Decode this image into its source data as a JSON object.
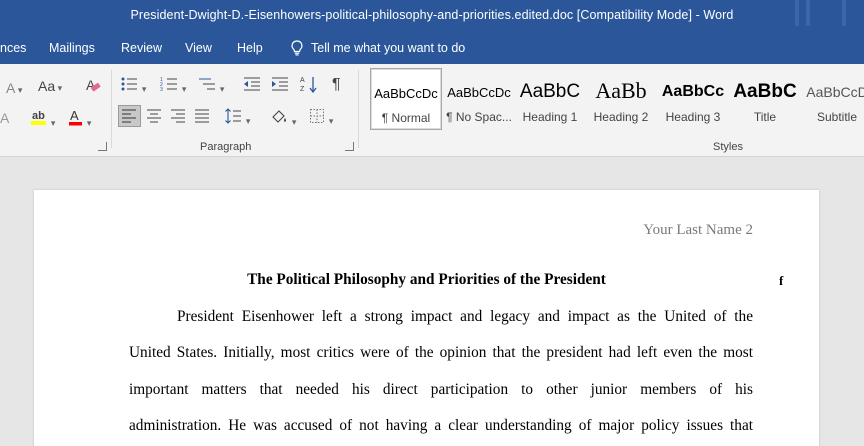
{
  "window": {
    "title": "President-Dwight-D.-Eisenhowers-political-philosophy-and-priorities.edited.doc [Compatibility Mode]  -  Word"
  },
  "menu": {
    "tabs": [
      "nces",
      "Mailings",
      "Review",
      "View",
      "Help"
    ],
    "tell_me": "Tell me what you want to do",
    "tell_me_icon": "lightbulb-icon"
  },
  "ribbon": {
    "font_group": {
      "change_case": "Aa",
      "clear_format_icon": "eraser-icon",
      "highlight_color": "#ffff00",
      "font_color": "#ff0000"
    },
    "paragraph_group": {
      "label": "Paragraph",
      "bullets_icon": "bullets-icon",
      "numbering_icon": "numbering-icon",
      "multilevel_icon": "multilevel-list-icon",
      "decrease_indent_icon": "decrease-indent-icon",
      "increase_indent_icon": "increase-indent-icon",
      "sort_icon": "sort-icon",
      "show_marks": "¶",
      "active_alignment": "align-left"
    },
    "styles_group": {
      "label": "Styles",
      "items": [
        {
          "sample": "AaBbCcDc",
          "name": "¶ Normal",
          "selected": true
        },
        {
          "sample": "AaBbCcDc",
          "name": "¶ No Spac..."
        },
        {
          "sample": "AaBbC",
          "name": "Heading 1"
        },
        {
          "sample": "AaBb",
          "name": "Heading 2"
        },
        {
          "sample": "AaBbCc",
          "name": "Heading 3"
        },
        {
          "sample": "AaBbC",
          "name": "Title"
        },
        {
          "sample": "AaBbCcD",
          "name": "Subtitle"
        }
      ]
    }
  },
  "document": {
    "header": "Your Last Name 2",
    "title": "The Political Philosophy and Priorities of the President",
    "stray_mark": "f",
    "paragraph_lines": [
      "President Eisenhower left a strong impact and legacy and impact as the United of the",
      "United States. Initially, most critics were of the opinion that the president had left even the most",
      "important matters that needed his direct participation to other junior members of his",
      "administration. He was accused of not having a clear understanding of major policy issues that"
    ]
  }
}
